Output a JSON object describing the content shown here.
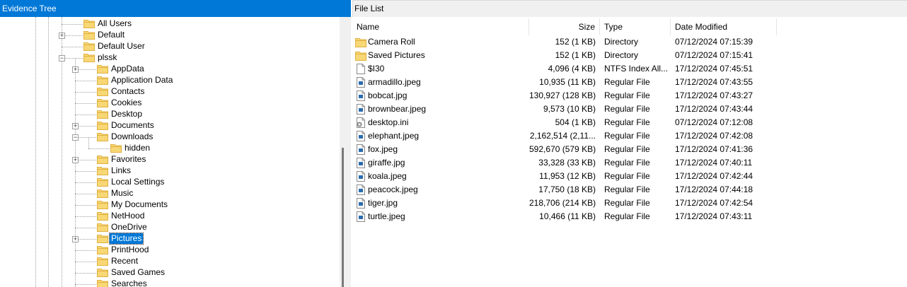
{
  "tree": {
    "title": "Evidence Tree",
    "nodes": [
      {
        "label": "All Users",
        "expander": ""
      },
      {
        "label": "Default",
        "expander": "+"
      },
      {
        "label": "Default User",
        "expander": ""
      },
      {
        "label": "plssk",
        "expander": "−"
      },
      {
        "label": "AppData",
        "expander": "+"
      },
      {
        "label": "Application Data",
        "expander": ""
      },
      {
        "label": "Contacts",
        "expander": ""
      },
      {
        "label": "Cookies",
        "expander": ""
      },
      {
        "label": "Desktop",
        "expander": ""
      },
      {
        "label": "Documents",
        "expander": "+"
      },
      {
        "label": "Downloads",
        "expander": "−"
      },
      {
        "label": "hidden",
        "expander": ""
      },
      {
        "label": "Favorites",
        "expander": "+"
      },
      {
        "label": "Links",
        "expander": ""
      },
      {
        "label": "Local Settings",
        "expander": ""
      },
      {
        "label": "Music",
        "expander": ""
      },
      {
        "label": "My Documents",
        "expander": ""
      },
      {
        "label": "NetHood",
        "expander": ""
      },
      {
        "label": "OneDrive",
        "expander": ""
      },
      {
        "label": "Pictures",
        "expander": "+",
        "selected": true
      },
      {
        "label": "PrintHood",
        "expander": ""
      },
      {
        "label": "Recent",
        "expander": ""
      },
      {
        "label": "Saved Games",
        "expander": ""
      },
      {
        "label": "Searches",
        "expander": ""
      }
    ]
  },
  "file_list": {
    "title": "File List",
    "columns": {
      "name": "Name",
      "size": "Size",
      "type": "Type",
      "date": "Date Modified"
    },
    "rows": [
      {
        "icon": "folder-icon",
        "name": "Camera Roll",
        "size": "152 (1 KB)",
        "type": "Directory",
        "date": "07/12/2024 07:15:39"
      },
      {
        "icon": "folder-icon",
        "name": "Saved Pictures",
        "size": "152 (1 KB)",
        "type": "Directory",
        "date": "07/12/2024 07:15:41"
      },
      {
        "icon": "file-icon",
        "name": "$I30",
        "size": "4,096 (4 KB)",
        "type": "NTFS Index All...",
        "date": "17/12/2024 07:45:51"
      },
      {
        "icon": "image-file-icon",
        "name": "armadillo.jpeg",
        "size": "10,935 (11 KB)",
        "type": "Regular File",
        "date": "17/12/2024 07:43:55"
      },
      {
        "icon": "image-file-icon",
        "name": "bobcat.jpg",
        "size": "130,927 (128 KB)",
        "type": "Regular File",
        "date": "17/12/2024 07:43:27"
      },
      {
        "icon": "image-file-icon",
        "name": "brownbear.jpeg",
        "size": "9,573 (10 KB)",
        "type": "Regular File",
        "date": "17/12/2024 07:43:44"
      },
      {
        "icon": "settings-file-icon",
        "name": "desktop.ini",
        "size": "504 (1 KB)",
        "type": "Regular File",
        "date": "07/12/2024 07:12:08"
      },
      {
        "icon": "image-file-icon",
        "name": "elephant.jpeg",
        "size": "2,162,514 (2,11...",
        "type": "Regular File",
        "date": "17/12/2024 07:42:08"
      },
      {
        "icon": "image-file-icon",
        "name": "fox.jpeg",
        "size": "592,670 (579 KB)",
        "type": "Regular File",
        "date": "17/12/2024 07:41:36"
      },
      {
        "icon": "image-file-icon",
        "name": "giraffe.jpg",
        "size": "33,328 (33 KB)",
        "type": "Regular File",
        "date": "17/12/2024 07:40:11"
      },
      {
        "icon": "image-file-icon",
        "name": "koala.jpeg",
        "size": "11,953 (12 KB)",
        "type": "Regular File",
        "date": "17/12/2024 07:42:44"
      },
      {
        "icon": "image-file-icon",
        "name": "peacock.jpeg",
        "size": "17,750 (18 KB)",
        "type": "Regular File",
        "date": "17/12/2024 07:44:18"
      },
      {
        "icon": "image-file-icon",
        "name": "tiger.jpg",
        "size": "218,706 (214 KB)",
        "type": "Regular File",
        "date": "17/12/2024 07:42:54"
      },
      {
        "icon": "image-file-icon",
        "name": "turtle.jpeg",
        "size": "10,466 (11 KB)",
        "type": "Regular File",
        "date": "17/12/2024 07:43:11"
      }
    ]
  },
  "colors": {
    "selection": "#0078d7",
    "folder": "#f8d775",
    "folder_dark": "#e0b040",
    "image_icon": "#2b6cb0"
  }
}
